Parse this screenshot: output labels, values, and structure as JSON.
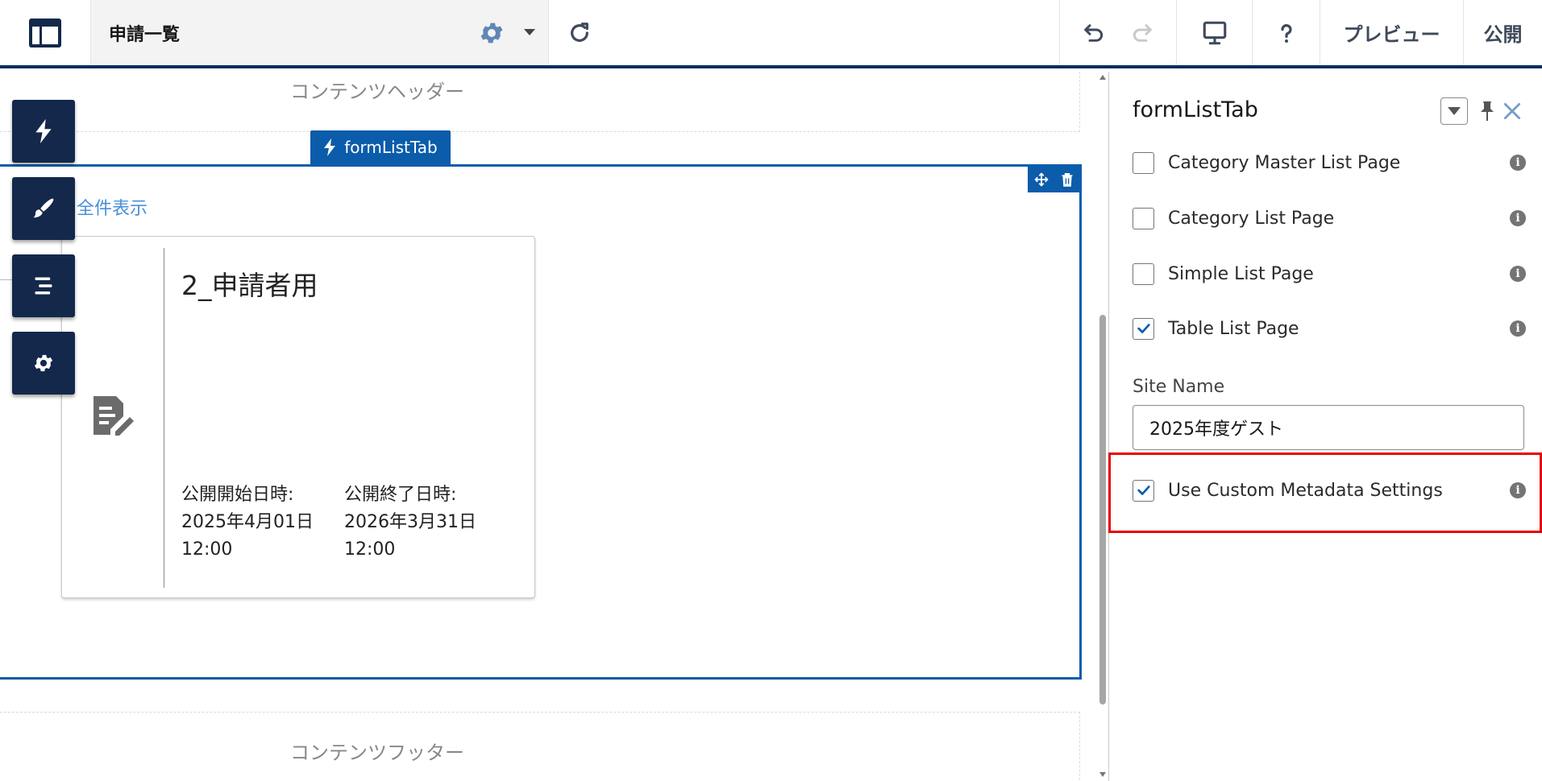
{
  "topbar": {
    "page_title": "申請一覧",
    "preview_label": "プレビュー",
    "publish_label": "公開"
  },
  "canvas": {
    "header_label": "コンテンツヘッダー",
    "footer_label": "コンテンツフッター",
    "component_tag": "formListTab",
    "view_all_link": "全件表示",
    "card": {
      "title": "2_申請者用",
      "start_date": "公開開始日時: 2025年4月01日 12:00",
      "end_date": "公開終了日時: 2026年3月31日 12:00"
    }
  },
  "tool_rail": {
    "items": [
      "components",
      "theme",
      "navigation",
      "settings"
    ]
  },
  "panel": {
    "title": "formListTab",
    "properties": [
      {
        "label": "Category Master List Page",
        "checked": false
      },
      {
        "label": "Category List Page",
        "checked": false
      },
      {
        "label": "Simple List Page",
        "checked": false
      },
      {
        "label": "Table List Page",
        "checked": true
      }
    ],
    "site_name_label": "Site Name",
    "site_name_value": "2025年度ゲスト",
    "custom_metadata": {
      "label": "Use Custom Metadata Settings",
      "checked": true
    }
  },
  "colors": {
    "brand_navy": "#032d60",
    "accent_blue": "#0b5cab",
    "highlight_red": "#e60000"
  }
}
